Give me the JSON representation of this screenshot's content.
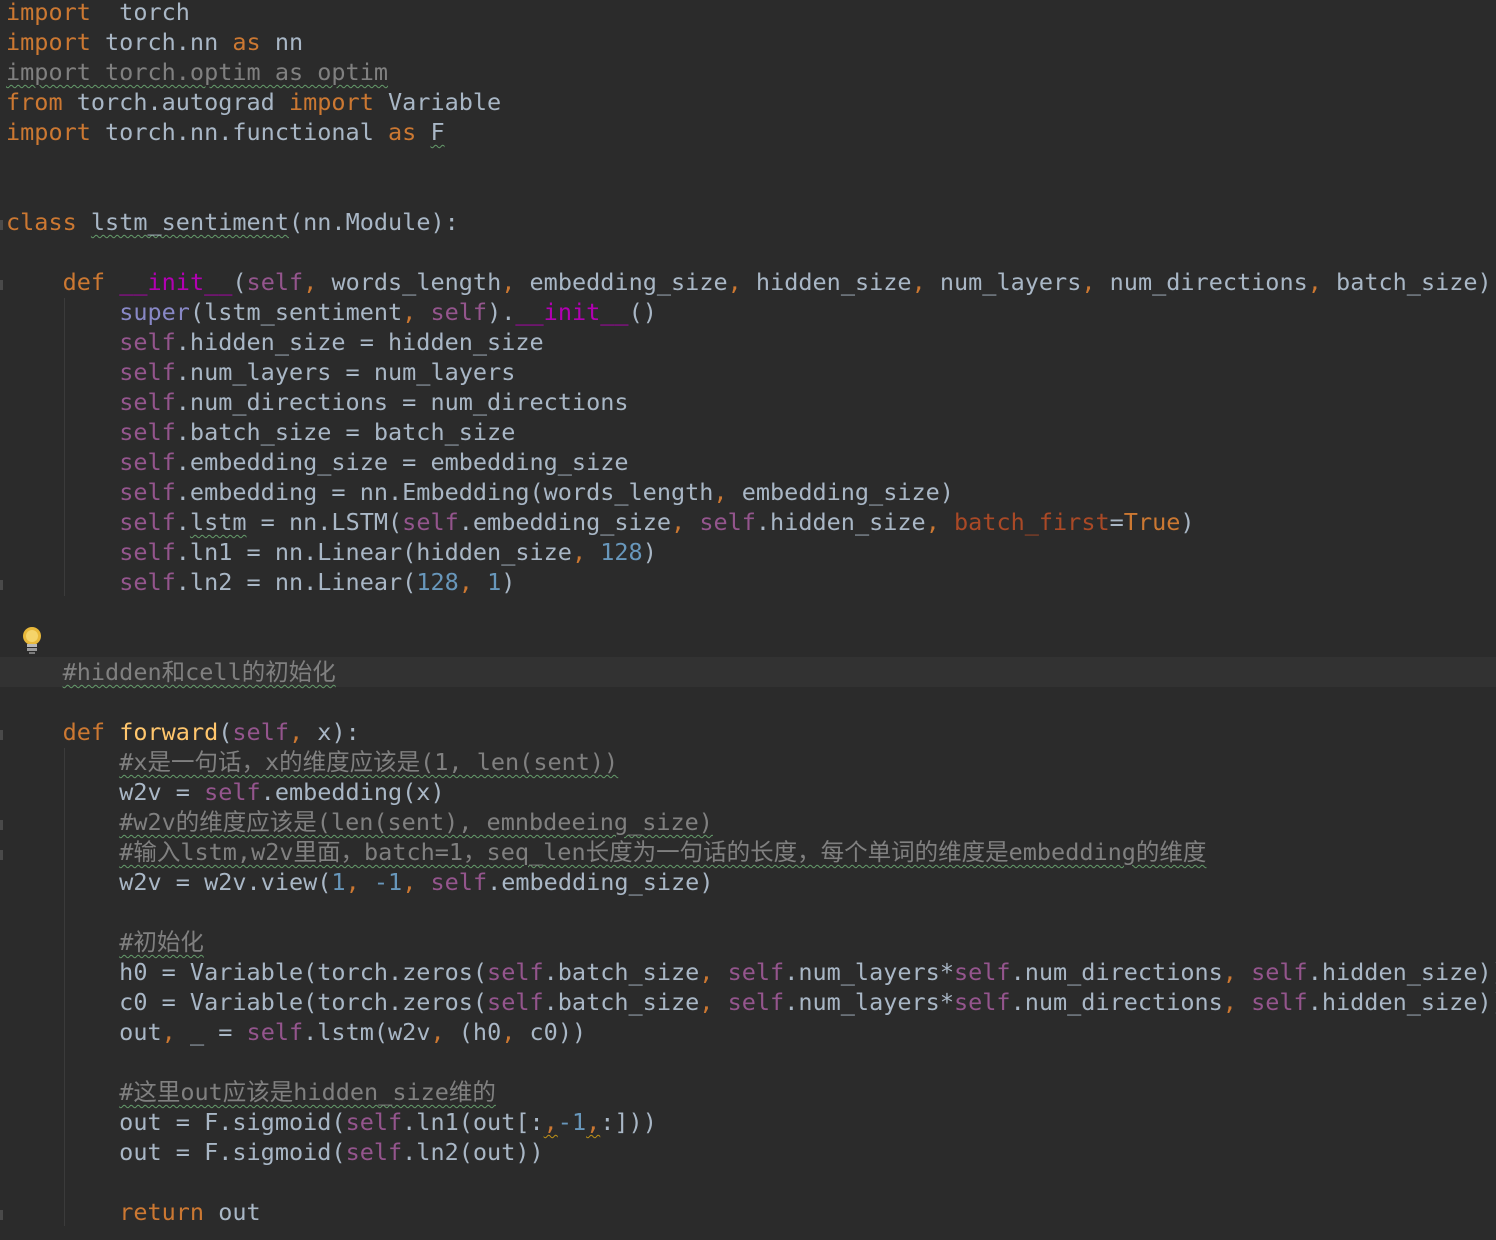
{
  "editor": {
    "colors": {
      "background": "#2b2b2b",
      "keyword": "#cc7832",
      "self": "#94558d",
      "number": "#6897bb",
      "comment": "#808080",
      "function_name": "#ffc66d",
      "default_text": "#a9b7c6"
    },
    "icons": [
      "lightbulb-icon"
    ],
    "lines": [
      {
        "row": 0,
        "tokens": [
          [
            "kw",
            "import"
          ],
          [
            "",
            "  torch"
          ]
        ]
      },
      {
        "row": 1,
        "tokens": [
          [
            "kw",
            "import"
          ],
          [
            "",
            " torch.nn "
          ],
          [
            "kw",
            "as"
          ],
          [
            "",
            " nn"
          ]
        ]
      },
      {
        "row": 2,
        "tokens": [
          [
            "unused squig",
            "import torch.optim as optim"
          ]
        ]
      },
      {
        "row": 3,
        "tokens": [
          [
            "kw",
            "from"
          ],
          [
            "",
            " torch.autograd "
          ],
          [
            "kw",
            "import"
          ],
          [
            "",
            " Variable"
          ]
        ]
      },
      {
        "row": 4,
        "tokens": [
          [
            "kw",
            "import"
          ],
          [
            "",
            " torch.nn.functional "
          ],
          [
            "kw",
            "as"
          ],
          [
            "",
            " "
          ],
          [
            "squig",
            "F"
          ]
        ]
      },
      {
        "row": 7,
        "tokens": [
          [
            "kw",
            "class"
          ],
          [
            "",
            " "
          ],
          [
            "squig",
            "lstm_sentiment"
          ],
          [
            "",
            "(nn.Module):"
          ]
        ]
      },
      {
        "row": 9,
        "tokens": [
          [
            "",
            "    "
          ],
          [
            "kw",
            "def"
          ],
          [
            "",
            " "
          ],
          [
            "magic",
            "__init__"
          ],
          [
            "",
            "("
          ],
          [
            "self",
            "self"
          ],
          [
            "kw",
            ","
          ],
          [
            "",
            " words_length"
          ],
          [
            "kw",
            ","
          ],
          [
            "",
            " embedding_size"
          ],
          [
            "kw",
            ","
          ],
          [
            "",
            " hidden_size"
          ],
          [
            "kw",
            ","
          ],
          [
            "",
            " num_layers"
          ],
          [
            "kw",
            ","
          ],
          [
            "",
            " num_directions"
          ],
          [
            "kw",
            ","
          ],
          [
            "",
            " batch_size):"
          ]
        ]
      },
      {
        "row": 10,
        "tokens": [
          [
            "",
            "        "
          ],
          [
            "sup",
            "super"
          ],
          [
            "",
            "(lstm_sentiment"
          ],
          [
            "kw",
            ","
          ],
          [
            "",
            " "
          ],
          [
            "self",
            "self"
          ],
          [
            "",
            ")."
          ],
          [
            "magic",
            "__init__"
          ],
          [
            "",
            "()"
          ]
        ]
      },
      {
        "row": 11,
        "tokens": [
          [
            "",
            "        "
          ],
          [
            "self",
            "self"
          ],
          [
            "",
            ".hidden_size = hidden_size"
          ]
        ]
      },
      {
        "row": 12,
        "tokens": [
          [
            "",
            "        "
          ],
          [
            "self",
            "self"
          ],
          [
            "",
            ".num_layers = num_layers"
          ]
        ]
      },
      {
        "row": 13,
        "tokens": [
          [
            "",
            "        "
          ],
          [
            "self",
            "self"
          ],
          [
            "",
            ".num_directions = num_directions"
          ]
        ]
      },
      {
        "row": 14,
        "tokens": [
          [
            "",
            "        "
          ],
          [
            "self",
            "self"
          ],
          [
            "",
            ".batch_size = batch_size"
          ]
        ]
      },
      {
        "row": 15,
        "tokens": [
          [
            "",
            "        "
          ],
          [
            "self",
            "self"
          ],
          [
            "",
            ".embedding_size = embedding_size"
          ]
        ]
      },
      {
        "row": 16,
        "tokens": [
          [
            "",
            "        "
          ],
          [
            "self",
            "self"
          ],
          [
            "",
            ".embedding = nn.Embedding(words_length"
          ],
          [
            "kw",
            ","
          ],
          [
            "",
            " embedding_size)"
          ]
        ]
      },
      {
        "row": 17,
        "tokens": [
          [
            "",
            "        "
          ],
          [
            "self",
            "self"
          ],
          [
            "",
            "."
          ],
          [
            "squig",
            "lstm"
          ],
          [
            "",
            " = nn.LSTM("
          ],
          [
            "self",
            "self"
          ],
          [
            "",
            ".embedding_size"
          ],
          [
            "kw",
            ","
          ],
          [
            "",
            " "
          ],
          [
            "self",
            "self"
          ],
          [
            "",
            ".hidden_size"
          ],
          [
            "kw",
            ","
          ],
          [
            "",
            " "
          ],
          [
            "param",
            "batch_first"
          ],
          [
            "",
            "="
          ],
          [
            "kw",
            "True"
          ],
          [
            "",
            ")"
          ]
        ]
      },
      {
        "row": 18,
        "tokens": [
          [
            "",
            "        "
          ],
          [
            "self",
            "self"
          ],
          [
            "",
            ".ln1 = nn.Linear(hidden_size"
          ],
          [
            "kw",
            ","
          ],
          [
            "",
            " "
          ],
          [
            "num",
            "128"
          ],
          [
            "",
            ")"
          ]
        ]
      },
      {
        "row": 19,
        "tokens": [
          [
            "",
            "        "
          ],
          [
            "self",
            "self"
          ],
          [
            "",
            ".ln2 = nn.Linear("
          ],
          [
            "num",
            "128"
          ],
          [
            "kw",
            ","
          ],
          [
            "",
            " "
          ],
          [
            "num",
            "1"
          ],
          [
            "",
            ")"
          ]
        ]
      },
      {
        "row": 22,
        "current": true,
        "tokens": [
          [
            "",
            "    "
          ],
          [
            "cmt squig",
            "#hidden和cell的初始化"
          ]
        ]
      },
      {
        "row": 24,
        "tokens": [
          [
            "",
            "    "
          ],
          [
            "kw",
            "def"
          ],
          [
            "",
            " "
          ],
          [
            "fn",
            "forward"
          ],
          [
            "",
            "("
          ],
          [
            "self",
            "self"
          ],
          [
            "kw",
            ","
          ],
          [
            "",
            " x):"
          ]
        ]
      },
      {
        "row": 25,
        "tokens": [
          [
            "",
            "        "
          ],
          [
            "cmt squig",
            "#x是一句话，x的维度应该是(1, len(sent))"
          ]
        ]
      },
      {
        "row": 26,
        "tokens": [
          [
            "",
            "        w2v = "
          ],
          [
            "self",
            "self"
          ],
          [
            "",
            ".embedding(x)"
          ]
        ]
      },
      {
        "row": 27,
        "tokens": [
          [
            "",
            "        "
          ],
          [
            "cmt squig",
            "#w2v的维度应该是(len(sent), emnbdeeing_size)"
          ]
        ]
      },
      {
        "row": 28,
        "tokens": [
          [
            "",
            "        "
          ],
          [
            "cmt squig",
            "#输入lstm,w2v里面，batch=1，seq_len长度为一句话的长度，每个单词的维度是embedding的维度"
          ]
        ]
      },
      {
        "row": 29,
        "tokens": [
          [
            "",
            "        w2v = w2v.view("
          ],
          [
            "num",
            "1"
          ],
          [
            "kw",
            ","
          ],
          [
            "",
            " "
          ],
          [
            "num",
            "-1"
          ],
          [
            "kw",
            ","
          ],
          [
            "",
            " "
          ],
          [
            "self",
            "self"
          ],
          [
            "",
            ".embedding_size)"
          ]
        ]
      },
      {
        "row": 31,
        "tokens": [
          [
            "",
            "        "
          ],
          [
            "cmt squig",
            "#初始化"
          ]
        ]
      },
      {
        "row": 32,
        "tokens": [
          [
            "",
            "        h0 = Variable(torch.zeros("
          ],
          [
            "self",
            "self"
          ],
          [
            "",
            ".batch_size"
          ],
          [
            "kw",
            ","
          ],
          [
            "",
            " "
          ],
          [
            "self",
            "self"
          ],
          [
            "",
            ".num_layers*"
          ],
          [
            "self",
            "self"
          ],
          [
            "",
            ".num_directions"
          ],
          [
            "kw",
            ","
          ],
          [
            "",
            " "
          ],
          [
            "self",
            "self"
          ],
          [
            "",
            ".hidden_size))"
          ]
        ]
      },
      {
        "row": 33,
        "tokens": [
          [
            "",
            "        c0 = Variable(torch.zeros("
          ],
          [
            "self",
            "self"
          ],
          [
            "",
            ".batch_size"
          ],
          [
            "kw",
            ","
          ],
          [
            "",
            " "
          ],
          [
            "self",
            "self"
          ],
          [
            "",
            ".num_layers*"
          ],
          [
            "self",
            "self"
          ],
          [
            "",
            ".num_directions"
          ],
          [
            "kw",
            ","
          ],
          [
            "",
            " "
          ],
          [
            "self",
            "self"
          ],
          [
            "",
            ".hidden_size))"
          ]
        ]
      },
      {
        "row": 34,
        "tokens": [
          [
            "",
            "        out"
          ],
          [
            "kw",
            ","
          ],
          [
            "",
            " _ = "
          ],
          [
            "self",
            "self"
          ],
          [
            "",
            ".lstm(w2v"
          ],
          [
            "kw",
            ","
          ],
          [
            "",
            " (h0"
          ],
          [
            "kw",
            ","
          ],
          [
            "",
            " c0))"
          ]
        ]
      },
      {
        "row": 36,
        "tokens": [
          [
            "",
            "        "
          ],
          [
            "cmt squig",
            "#这里out应该是hidden_size维的"
          ]
        ]
      },
      {
        "row": 37,
        "tokens": [
          [
            "",
            "        out = F.sigmoid("
          ],
          [
            "self",
            "self"
          ],
          [
            "",
            ".ln1(out[:"
          ],
          [
            "kw warn",
            ","
          ],
          [
            "num",
            "-1"
          ],
          [
            "kw warn",
            ","
          ],
          [
            "",
            ":]))"
          ]
        ]
      },
      {
        "row": 38,
        "tokens": [
          [
            "",
            "        out = F.sigmoid("
          ],
          [
            "self",
            "self"
          ],
          [
            "",
            ".ln2(out))"
          ]
        ]
      },
      {
        "row": 40,
        "tokens": [
          [
            "",
            "        "
          ],
          [
            "kw",
            "return"
          ],
          [
            "",
            " out"
          ]
        ]
      }
    ]
  }
}
